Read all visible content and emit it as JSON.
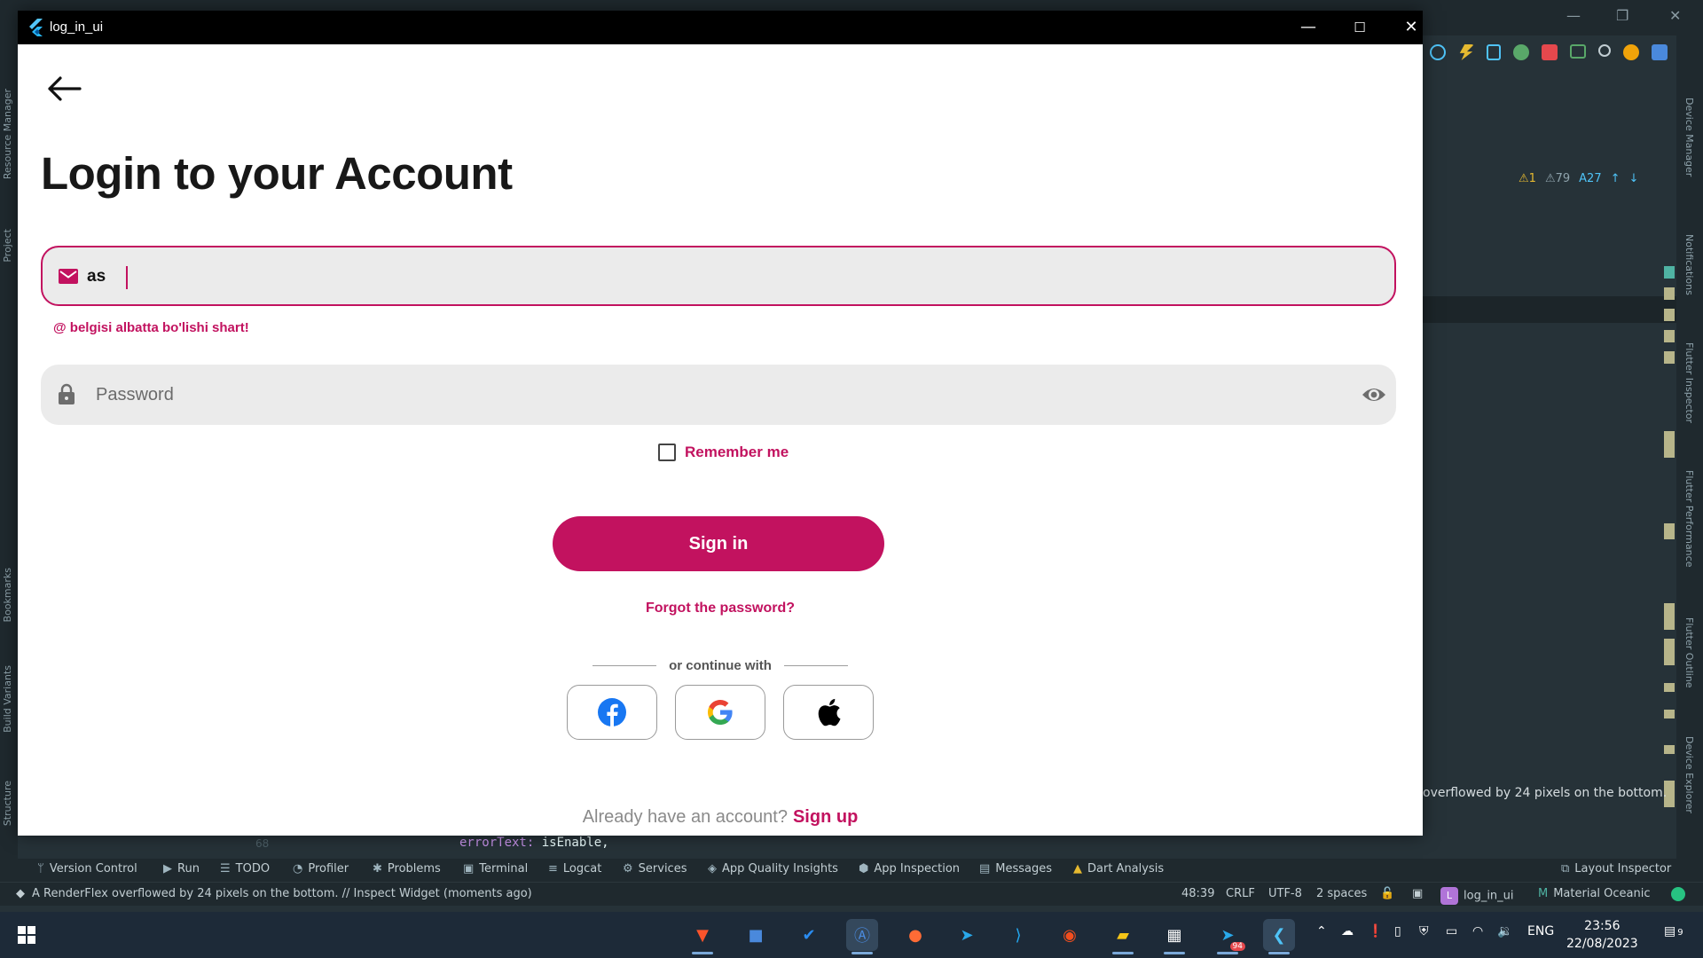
{
  "window": {
    "title": "log_in_ui",
    "minimize": "—",
    "maximize": "☐",
    "close": "✕"
  },
  "login": {
    "heading": "Login to your Account",
    "email_value": "as",
    "email_error": "@ belgisi albatta bo'lishi shart!",
    "password_placeholder": "Password",
    "remember_label": "Remember me",
    "signin_label": "Sign in",
    "forgot_label": "Forgot the password?",
    "divider_text": "or continue  with",
    "footer_question": "Already have an account?",
    "footer_link": "Sign up"
  },
  "colors": {
    "accent": "#c2125f",
    "titlebar": "#000000",
    "field_bg": "#ebebeb"
  },
  "ide": {
    "left_tabs": [
      "Resource Manager",
      "Project",
      "Bookmarks",
      "Build Variants",
      "Structure"
    ],
    "right_tabs": [
      "Device Manager",
      "Notifications",
      "Flutter Inspector",
      "Flutter Performance",
      "Flutter Outline",
      "Device Explorer"
    ],
    "warnings": {
      "w1": "1",
      "w2": "79",
      "w3": "27"
    },
    "overflow_message": "overflowed by 24 pixels on the bottom.",
    "code_line": {
      "keyword": "errorText",
      "value": "isEnable,"
    },
    "line_number": "68",
    "toolwindows": [
      "Version Control",
      "Run",
      "TODO",
      "Profiler",
      "Problems",
      "Terminal",
      "Logcat",
      "Services",
      "App Quality Insights",
      "App Inspection",
      "Messages",
      "Dart Analysis"
    ],
    "layout_inspector": "Layout Inspector",
    "status_message": "A RenderFlex overflowed by 24 pixels on the bottom. // Inspect Widget (moments ago)",
    "caret_position": "48:39",
    "line_sep": "CRLF",
    "encoding": "UTF-8",
    "indent": "2 spaces",
    "project_badge": "L",
    "project_name": "log_in_ui",
    "theme": "Material Oceanic"
  },
  "taskbar": {
    "language": "ENG",
    "time": "23:56",
    "date": "22/08/2023",
    "telegram_badge": "94",
    "notification_count": "9"
  }
}
